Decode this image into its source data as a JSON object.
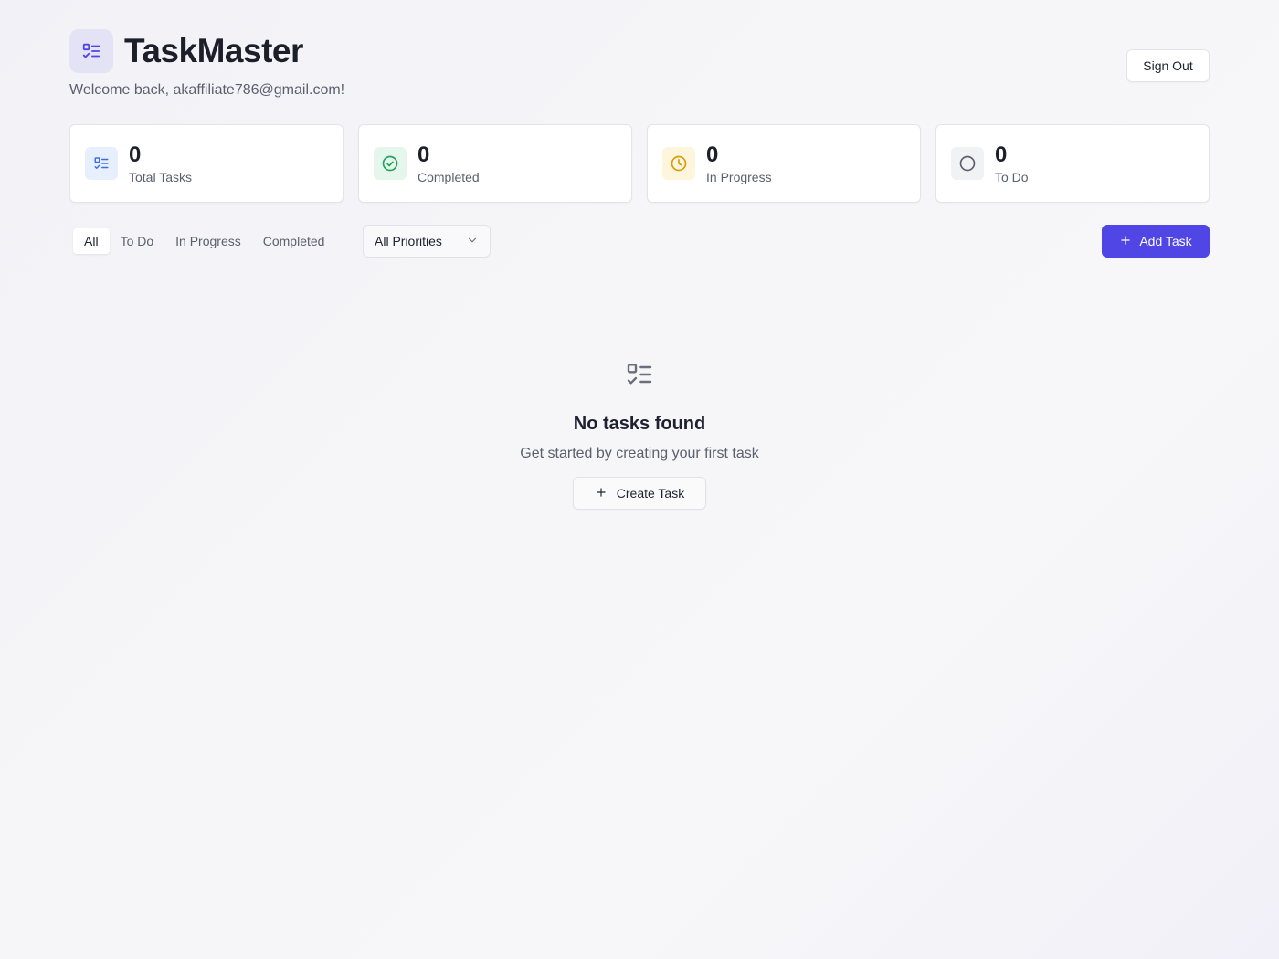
{
  "header": {
    "title": "TaskMaster",
    "welcome": "Welcome back, akaffiliate786@gmail.com!",
    "sign_out_label": "Sign Out"
  },
  "stats": [
    {
      "value": "0",
      "label": "Total Tasks",
      "icon": "list-check-icon",
      "color": "#3b6ee6",
      "bg": "#e8effc"
    },
    {
      "value": "0",
      "label": "Completed",
      "icon": "check-circle-icon",
      "color": "#22a35a",
      "bg": "#e5f6ec"
    },
    {
      "value": "0",
      "label": "In Progress",
      "icon": "clock-icon",
      "color": "#d89c09",
      "bg": "#fdf5dc"
    },
    {
      "value": "0",
      "label": "To Do",
      "icon": "circle-icon",
      "color": "#5c5f6e",
      "bg": "#f1f2f4"
    }
  ],
  "filters": {
    "tabs": [
      "All",
      "To Do",
      "In Progress",
      "Completed"
    ],
    "active_tab": "All",
    "priority_selected": "All Priorities"
  },
  "add_task_label": "Add Task",
  "empty_state": {
    "title": "No tasks found",
    "subtitle": "Get started by creating your first task",
    "button_label": "Create Task"
  },
  "colors": {
    "accent": "#4f46e5",
    "logo_bg": "#e4e2f5"
  }
}
